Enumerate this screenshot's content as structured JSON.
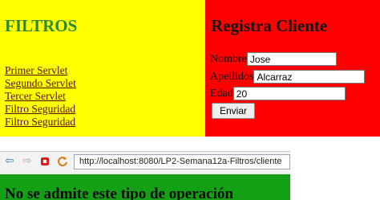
{
  "filtros_frame": {
    "title": "FILTROS",
    "links": [
      "Primer Servlet",
      "Segundo Servlet",
      "Tercer Servlet",
      "Filtro Seguridad",
      "Filtro Seguridad"
    ],
    "background": "#ffff00",
    "title_color": "#2a8a2a"
  },
  "cliente_frame": {
    "title": "Registra Cliente",
    "background": "#ff0000",
    "fields": {
      "nombre": {
        "label": "Nombre",
        "value": "Jose"
      },
      "apellidos": {
        "label": "Apellidos",
        "value": "Alcarraz"
      },
      "edad": {
        "label": "Edad",
        "value": "20"
      }
    },
    "submit_label": "Enviar"
  },
  "browser": {
    "toolbar_icons": [
      "back-arrow-icon",
      "forward-arrow-icon",
      "stop-icon",
      "refresh-icon"
    ],
    "address": "http://localhost:8080/LP2-Semana12a-Filtros/cliente",
    "page_background": "#14a014",
    "message": "No se admite este tipo de operación"
  }
}
